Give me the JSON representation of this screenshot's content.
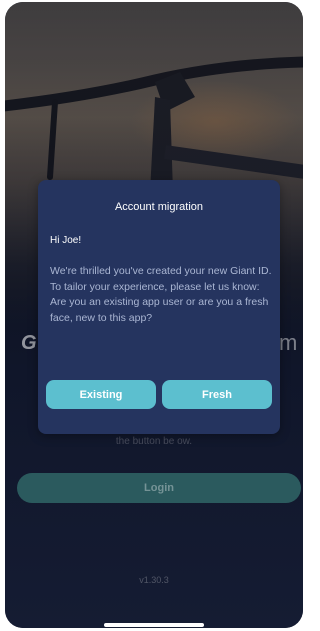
{
  "background": {
    "brand_left": "G",
    "brand_right": "m",
    "helper_text": "the button be ow.",
    "login_label": "Login",
    "version": "v1.30.3"
  },
  "dialog": {
    "title": "Account migration",
    "greeting": "Hi Joe!",
    "body": "We're thrilled you've created your new Giant ID. To tailor your experience, please let us know:\nAre you an existing app user or are you a fresh face, new to this app?",
    "existing_label": "Existing",
    "fresh_label": "Fresh"
  },
  "colors": {
    "dialog_bg": "#25345f",
    "button_accent": "#5cbfcf",
    "login_button": "#2b5a5e",
    "app_bg": "#141a2e"
  }
}
